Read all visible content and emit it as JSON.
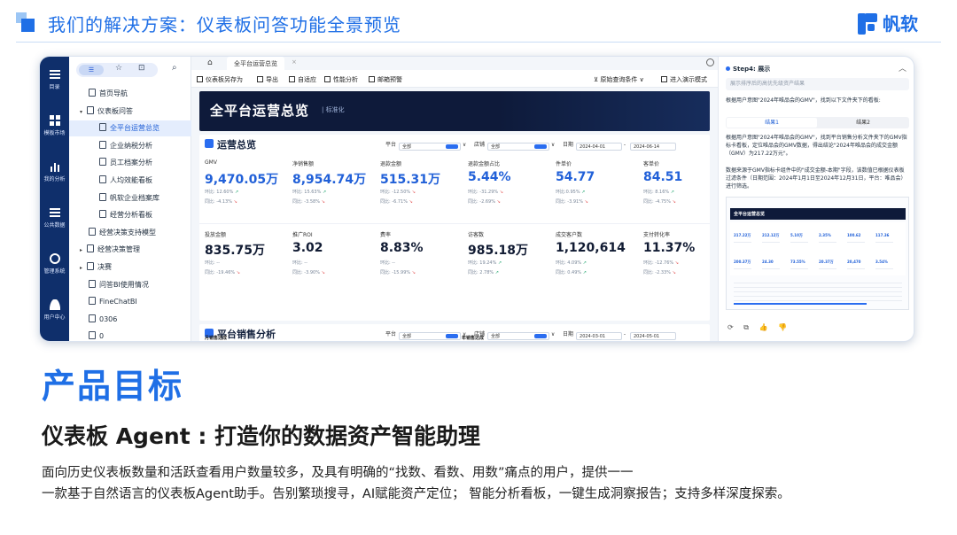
{
  "slide": {
    "header_title": "我们的解决方案：仪表板问答功能全景预览",
    "logo_text": "帆软",
    "goal_title": "产品目标",
    "subtitle": "仪表板 Agent : 打造你的数据资产智能助理",
    "desc_line1": "面向历史仪表板数量和活跃查看用户数量较多，及具有明确的“找数、看数、用数”痛点的用户，提供一一",
    "desc_line2": "一款基于自然语言的仪表板Agent助手。告别繁琐搜寻，AI赋能资产定位； 智能分析看板，一键生成洞察报告；支持多样深度探索。"
  },
  "rail": [
    {
      "label": "目录",
      "icon": "catalog-icon"
    },
    {
      "label": "模板市场",
      "icon": "grid-icon"
    },
    {
      "label": "我的分析",
      "icon": "bar-chart-icon"
    },
    {
      "label": "公共数据",
      "icon": "database-icon"
    },
    {
      "label": "管理系统",
      "icon": "gear-icon"
    },
    {
      "label": "用户中心",
      "icon": "user-icon"
    }
  ],
  "nav": {
    "toggle_icon": "☰",
    "star_icon": "☆",
    "doc_icon": "⊡",
    "search_icon": "⌕",
    "items": [
      {
        "label": "首页导航",
        "level": 1,
        "caret": ""
      },
      {
        "label": "仪表板问答",
        "level": 0,
        "caret": "▾"
      },
      {
        "label": "全平台运营总览",
        "level": 2,
        "caret": ""
      },
      {
        "label": "企业纳税分析",
        "level": 2,
        "caret": ""
      },
      {
        "label": "员工档案分析",
        "level": 2,
        "caret": ""
      },
      {
        "label": "人均效能看板",
        "level": 2,
        "caret": ""
      },
      {
        "label": "帆软企业档案库",
        "level": 2,
        "caret": ""
      },
      {
        "label": "经营分析看板",
        "level": 2,
        "caret": ""
      },
      {
        "label": "经营决策支持模型",
        "level": 1,
        "caret": ""
      },
      {
        "label": "经营决策管理",
        "level": 0,
        "caret": "▸"
      },
      {
        "label": "决赛",
        "level": 0,
        "caret": "▸"
      },
      {
        "label": "问答BI使用情况",
        "level": 1,
        "caret": ""
      },
      {
        "label": "FineChatBI",
        "level": 1,
        "caret": ""
      },
      {
        "label": "0306",
        "level": 1,
        "caret": ""
      },
      {
        "label": "0",
        "level": 1,
        "caret": ""
      }
    ]
  },
  "dashboard": {
    "tab_label": "全平台运营总览",
    "tab_close": "×",
    "home_icon": "⌂",
    "toolbar": [
      "仪表板另存为",
      "导出",
      "自适应",
      "性能分析",
      "邮箱预警"
    ],
    "toolbar_right": [
      "原始查询条件",
      "进入演示模式"
    ],
    "banner_title": "全平台运营总览",
    "banner_sub": "| 标准化",
    "section1_title": "运营总览",
    "section2_title": "平台销售分析",
    "filters1": {
      "platform_label": "平台",
      "platform_value": "全部",
      "store_label": "店铺",
      "store_value": "全部",
      "date_label": "日期",
      "date_from": "2024-04-01",
      "date_to": "2024-06-14"
    },
    "filters2": {
      "platform_label": "平台",
      "platform_value": "全部",
      "store_label": "店铺",
      "store_value": "全部",
      "date_label": "日期",
      "date_from": "2024-03-01",
      "date_to": "2024-05-01"
    },
    "kpis": [
      {
        "label": "GMV",
        "value": "9,470.05万",
        "mom": "环比: 12.60% ↗",
        "yoy": "同比: -4.13% ↘"
      },
      {
        "label": "净销售额",
        "value": "8,954.74万",
        "mom": "环比: 15.63% ↗",
        "yoy": "同比: -3.58% ↘"
      },
      {
        "label": "退款金额",
        "value": "515.31万",
        "mom": "环比: -12.50% ↘",
        "yoy": "同比: -6.71% ↘"
      },
      {
        "label": "退款金额占比",
        "value": "5.44%",
        "mom": "环比: -31.29% ↘",
        "yoy": "同比: -2.69% ↘"
      },
      {
        "label": "件单价",
        "value": "54.77",
        "mom": "环比:0.95% ↗",
        "yoy": "同比: -3.91% ↘"
      },
      {
        "label": "客单价",
        "value": "84.51",
        "mom": "环比: 8.16% ↗",
        "yoy": "同比: -4.75% ↘"
      },
      {
        "label": "投放金额",
        "value": "835.75万",
        "mom": "环比: --",
        "yoy": "同比: -19.46% ↘"
      },
      {
        "label": "推广ROI",
        "value": "3.02",
        "mom": "环比: --",
        "yoy": "同比: -3.90% ↘"
      },
      {
        "label": "费率",
        "value": "8.83%",
        "mom": "环比: --",
        "yoy": "同比: -15.99% ↘"
      },
      {
        "label": "访客数",
        "value": "985.18万",
        "mom": "环比: 19.24% ↗",
        "yoy": "同比: 2.78% ↗"
      },
      {
        "label": "成交客户数",
        "value": "1,120,614",
        "mom": "环比: 4.09% ↗",
        "yoy": "同比: 0.49% ↗"
      },
      {
        "label": "支付转化率",
        "value": "11.37%",
        "mom": "环比: -12.76% ↘",
        "yoy": "同比: -2.33% ↘"
      }
    ],
    "sub_left": "月销售达成",
    "sub_right": "年销售达成"
  },
  "chat": {
    "step_title": "Step4: 展示",
    "collapse_icon": "︿",
    "input_placeholder": "展示排序后的高优先级资产结果",
    "msg1": "根据用户意图\"2024年唯品会的GMV\"，找到以下文件夹下的看板:",
    "result_tabs": [
      "结果1",
      "结果2"
    ],
    "msg2": "根据用户意图\"2024年唯品会的GMV\"，找到平台销售分析文件夹下的GMV指标卡看板，定位唯品会的GMV数据，得出结论\"2024年唯品会的成交金额（GMV）为217.22万元\"。",
    "msg3": "数据来源于GMV指标卡组件中的\"成交金额-本期\"字段，该数值已根据仪表板过滤条件（日期范围：2024年1月1日至2024年12月31日，平台：唯品会）进行筛选。",
    "thumb_title": "全平台运营总览",
    "thumb_values": [
      "217.22万",
      "212.12万",
      "5.10万",
      "2.35%",
      "100.62",
      "117.36",
      "200.37万",
      "24.30",
      "73.55%",
      "20.37万",
      "20,470",
      "3.54%"
    ],
    "actions": [
      "⟳",
      "⧉",
      "👍",
      "👎"
    ]
  }
}
